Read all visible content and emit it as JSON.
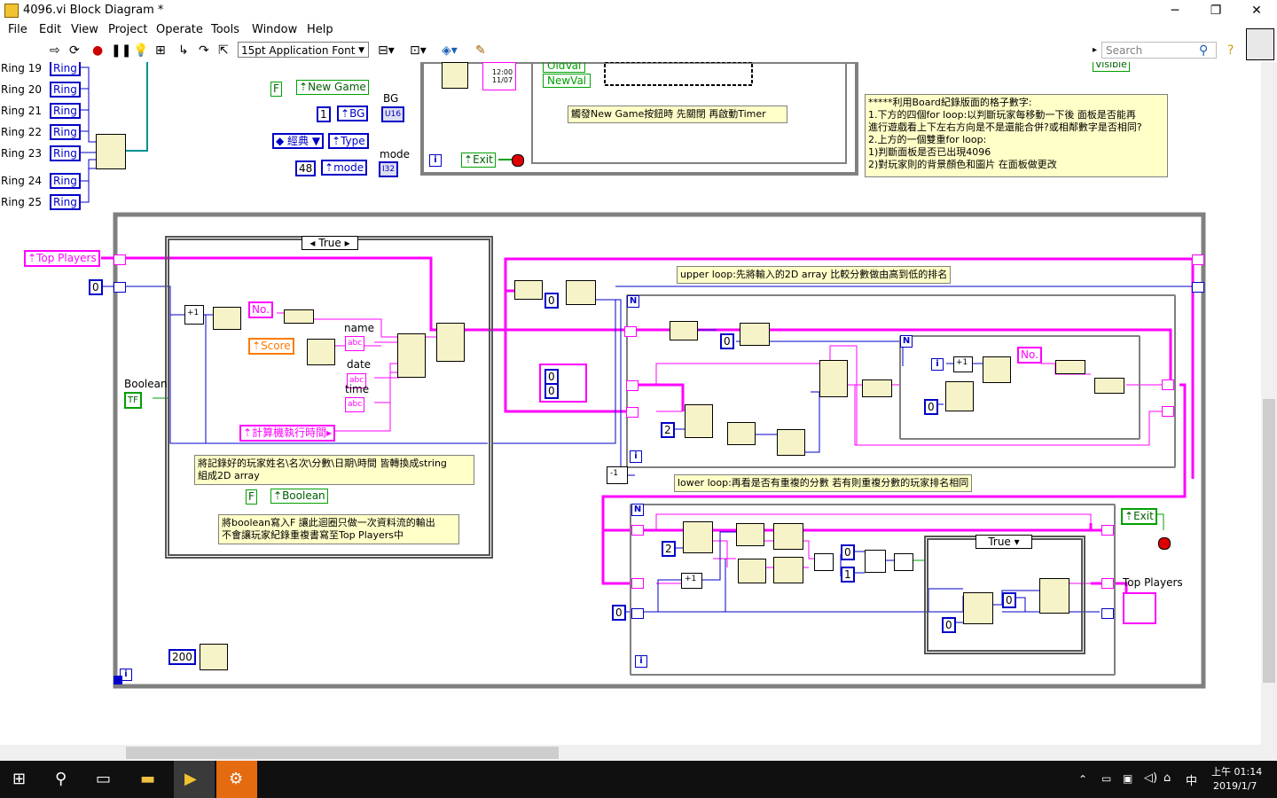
{
  "window": {
    "title": "4096.vi Block Diagram *",
    "minimize": "─",
    "maximize": "❐",
    "close": "✕"
  },
  "menu": [
    "File",
    "Edit",
    "View",
    "Project",
    "Operate",
    "Tools",
    "Window",
    "Help"
  ],
  "toolbar": {
    "font_select": "15pt Application Font",
    "search_placeholder": "Search"
  },
  "rings": [
    {
      "label": "Ring 19",
      "value": "Ring"
    },
    {
      "label": "Ring 20",
      "value": "Ring"
    },
    {
      "label": "Ring 21",
      "value": "Ring"
    },
    {
      "label": "Ring 22",
      "value": "Ring"
    },
    {
      "label": "Ring 23",
      "value": "Ring"
    },
    {
      "label": "Ring 24",
      "value": "Ring"
    },
    {
      "label": "Ring 25",
      "value": "Ring"
    }
  ],
  "top_controls": {
    "new_game_const": "F",
    "new_game": "New Game",
    "bg_label": "BG",
    "bg_const": "1",
    "bg": "BG",
    "bg_type": "U16",
    "type_const": "經典",
    "type": "Type",
    "mode_label": "mode",
    "mode_const": "48",
    "mode": "mode",
    "mode_type": "I32"
  },
  "event_area": {
    "oldval": "OldVal",
    "newval": "NewVal",
    "clock_text": "12:00 11/07",
    "timer_note": "觸發New Game按鈕時 先關閉 再啟動Timer",
    "exit": "Exit"
  },
  "note_board": [
    "*****利用Board紀錄版面的格子數字:",
    "1.下方的四個for loop:以判斷玩家每移動一下後 面板是否能再",
    "進行遊戲看上下左右方向是不是還能合併?或相鄰數字是否相同?",
    "2.上方的一個雙重for loop:",
    "1)判斷面板是否已出現4096",
    "2)對玩家則的背景顏色和圖片 在面板做更改"
  ],
  "visible_tag": "Visible",
  "main": {
    "top_players": "Top Players",
    "zero_const": "0",
    "case_selector": "True",
    "no_label": "No.",
    "score": "Score",
    "name_label": "name",
    "date_label": "date",
    "time_label": "time",
    "abc": "abc",
    "boolean_label": "Boolean",
    "bool_const": "TF",
    "runtime": "計算機執行時間",
    "note_convert": [
      "將記錄好的玩家姓名\\名次\\分數\\日期\\時間 皆轉換成string",
      "組成2D array"
    ],
    "false_const": "F",
    "boolean_local": "Boolean",
    "note_boolean": [
      "將boolean寫入F 讓此迴圈只做一次資料流的輸出",
      "不會讓玩家紀錄重複書寫至Top Players中"
    ],
    "wait_const": "200",
    "upper_note": "upper loop:先將輸入的2D array 比較分數做由高到低的排名",
    "lower_note": "lower loop:再看是否有重複的分數 若有則重複分數的玩家排名相同",
    "N": "N",
    "i": "i",
    "const_0": "0",
    "const_1": "1",
    "const_2": "2",
    "plus1": "+1",
    "minus1": "-1",
    "no_label2": "No.",
    "inner_case": "True",
    "exit2": "Exit",
    "top_players_ind": "Top Players"
  },
  "taskbar": {
    "time": "上午 01:14",
    "date": "2019/1/7",
    "ime": "中"
  },
  "colors": {
    "string_wire": "#ff00ff",
    "int_wire": "#0000c8",
    "bool_wire": "#00a000",
    "note_bg": "#ffffc8"
  }
}
